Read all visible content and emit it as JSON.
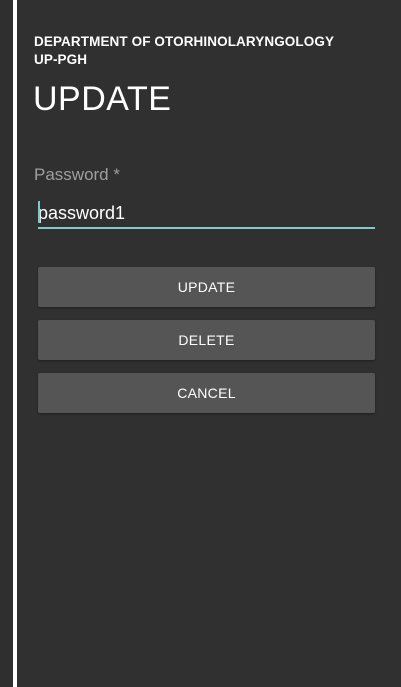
{
  "dialog": {
    "department": "DEPARTMENT OF OTORHINOLARYNGOLOGY",
    "institution": "UP-PGH",
    "title": "UPDATE"
  },
  "form": {
    "password_label": "Password *",
    "password_value": "password1"
  },
  "buttons": {
    "update_label": "UPDATE",
    "delete_label": "DELETE",
    "cancel_label": "CANCEL"
  },
  "colors": {
    "background": "#303030",
    "accent": "#80cbc4",
    "button": "#555555",
    "label": "#9e9e9e"
  }
}
